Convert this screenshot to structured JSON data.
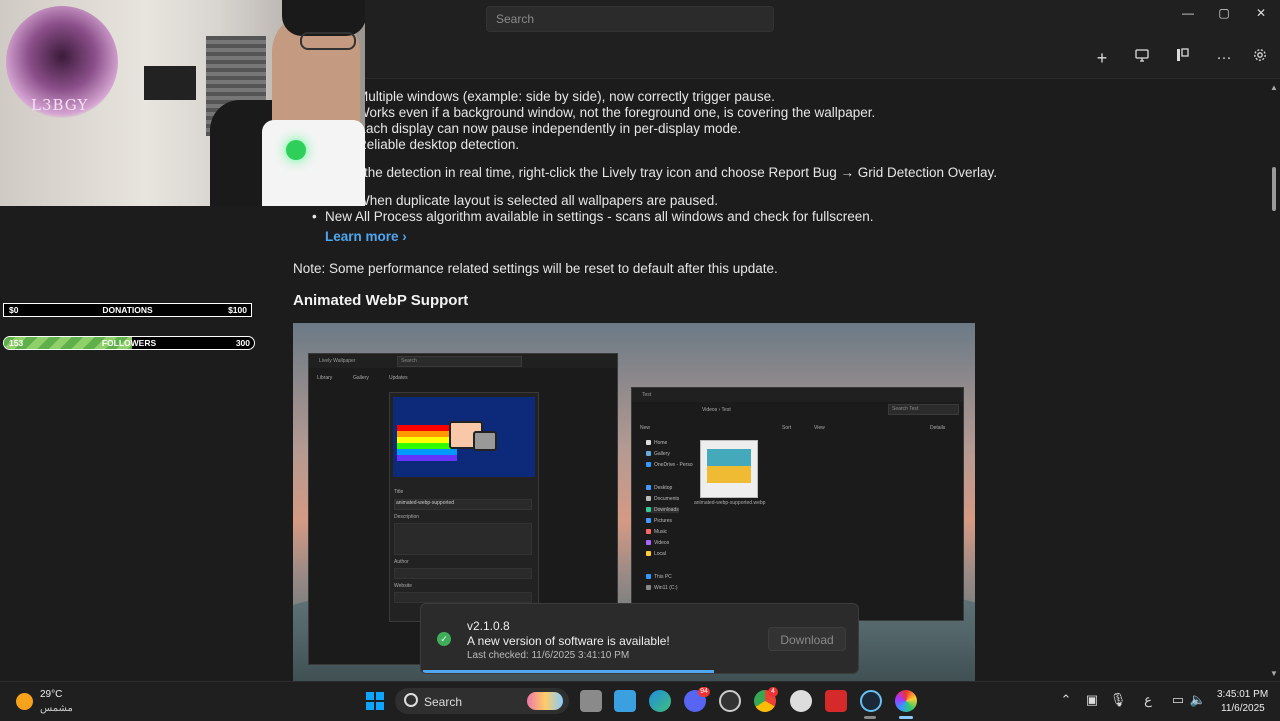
{
  "titlebar": {
    "search_placeholder": "Search",
    "minimize": "—",
    "maximize": "▢",
    "close": "✕"
  },
  "toolbar": {
    "add_label": "+",
    "more_label": "···"
  },
  "content": {
    "lines": [
      "Multiple windows (example: side by side), now correctly trigger pause.",
      "Works even if a background window, not the foreground one, is covering the wallpaper.",
      "Each display can now pause independently in per-display mode.",
      "Reliable desktop detection.",
      "the detection in real time, right-click the Lively tray icon and choose Report Bug → Grid Detection Overlay.",
      "When duplicate layout is selected all wallpapers are paused.",
      "New All Process algorithm available in settings - scans all windows and check for fullscreen."
    ],
    "learn_more": "Learn more",
    "note": "Note: Some performance related settings will be reset to default after this update.",
    "heading": "Animated WebP Support"
  },
  "preview": {
    "lively_title": "Lively Wallpaper",
    "lively_search": "Search",
    "tabs": [
      "Library",
      "Gallery",
      "Updates"
    ],
    "field_title_label": "Title",
    "field_title_value": "animated-webp-supported",
    "field_description_label": "Description",
    "field_author_label": "Author",
    "field_website_label": "Website",
    "explorer_tab": "Test",
    "explorer_path": "Videos  ›  Test",
    "explorer_search": "Search Test",
    "explorer_new": "New",
    "explorer_sort": "Sort",
    "explorer_view": "View",
    "explorer_details": "Details",
    "nav_items": [
      "Home",
      "Gallery",
      "OneDrive - Perso",
      "Desktop",
      "Documents",
      "Downloads",
      "Pictures",
      "Music",
      "Videos",
      "Local",
      "This PC",
      "Win11 (C:)"
    ],
    "file_name": "animated-webp-supported.webp"
  },
  "overlay": {
    "logo_text": "L3BGY",
    "donations": {
      "left": "$0",
      "label": "DONATIONS",
      "right": "$100",
      "progress": 0
    },
    "followers": {
      "left": "153",
      "label": "FOLLOWERS",
      "right": "300",
      "progress": 0.51
    }
  },
  "toast": {
    "version": "v2.1.0.8",
    "message": "A new version of software is available!",
    "last_checked": "Last checked: 11/6/2025 3:41:10 PM",
    "download": "Download",
    "progress": 0.67
  },
  "taskbar": {
    "weather_temp": "29°C",
    "weather_desc": "مشمس",
    "search_label": "Search",
    "input_lang": "ع",
    "time": "3:45:01 PM",
    "date": "11/6/2025",
    "discord_badge": "94",
    "chrome_badge": "4"
  },
  "colors": {
    "accent": "#4ea7f0",
    "background": "#1c1c1c",
    "success": "#3fae5b"
  }
}
